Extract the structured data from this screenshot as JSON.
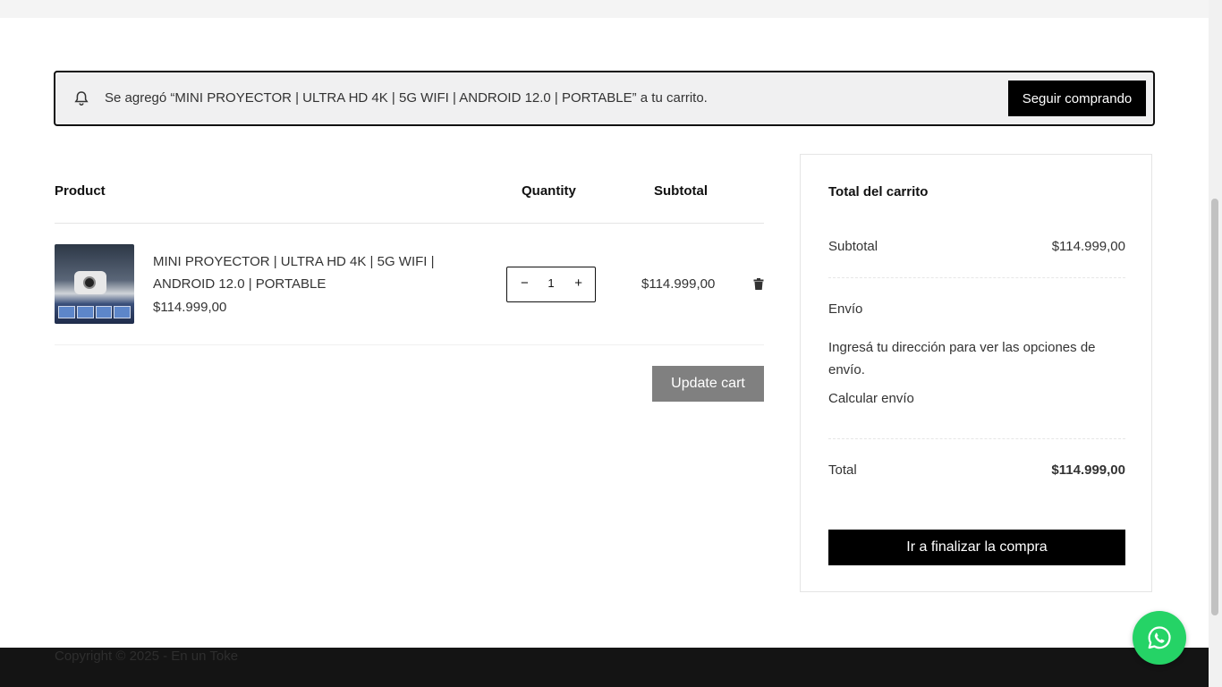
{
  "notice": {
    "message": "Se agregó “MINI PROYECTOR | ULTRA HD 4K | 5G WIFI | ANDROID 12.0 | PORTABLE” a tu carrito.",
    "button_label": "Seguir comprando",
    "icon": "bell-icon"
  },
  "cart": {
    "headers": {
      "product": "Product",
      "quantity": "Quantity",
      "subtotal": "Subtotal"
    },
    "items": [
      {
        "name": "MINI PROYECTOR | ULTRA HD 4K | 5G WIFI | ANDROID 12.0 | PORTABLE",
        "price": "$114.999,00",
        "quantity": "1",
        "subtotal": "$114.999,00",
        "minus_label": "−",
        "plus_label": "+",
        "remove_icon": "trash-icon"
      }
    ],
    "update_label": "Update cart"
  },
  "totals": {
    "title": "Total del carrito",
    "subtotal_label": "Subtotal",
    "subtotal_value": "$114.999,00",
    "shipping_label": "Envío",
    "shipping_note": "Ingresá tu dirección para ver las opciones de envío.",
    "calc_shipping": "Calcular envío",
    "total_label": "Total",
    "total_value": "$114.999,00",
    "checkout_label": "Ir a finalizar la compra"
  },
  "footer": {
    "copyright": "Copyright © 2025 - En un Toke"
  },
  "whatsapp": {
    "icon": "whatsapp-icon"
  },
  "colors": {
    "accent": "#000000",
    "whatsapp": "#25d366",
    "update_button": "#808080",
    "footer": "#141414"
  }
}
